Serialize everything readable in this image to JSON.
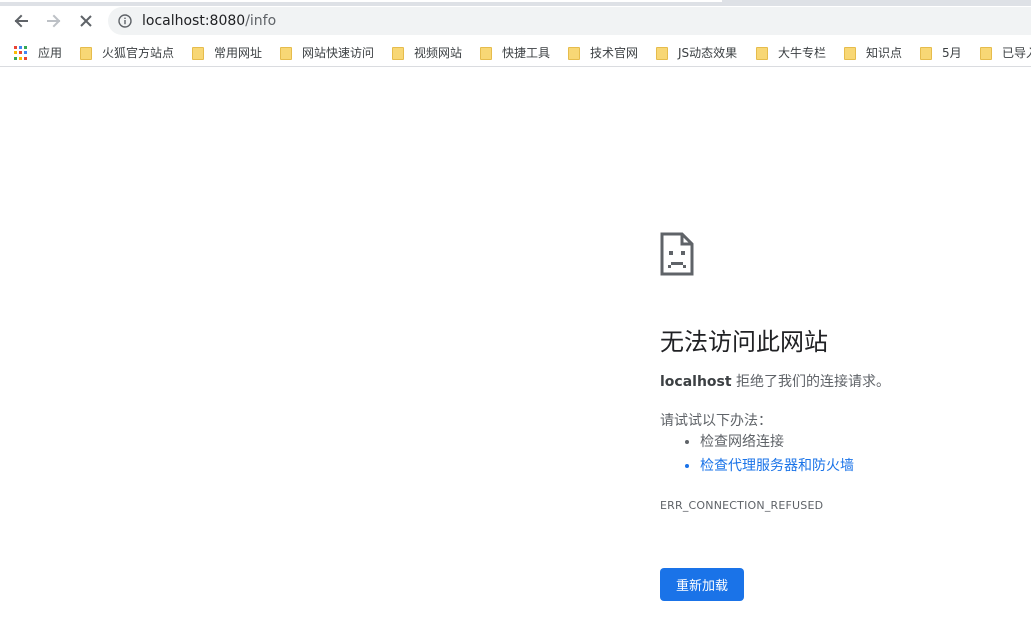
{
  "toolbar": {
    "back_icon": "arrow-left-icon",
    "forward_icon": "arrow-right-icon",
    "stop_icon": "close-icon",
    "security_icon": "info-icon",
    "url_host": "localhost:8080",
    "url_path": "/info"
  },
  "bookmarks": {
    "apps_label": "应用",
    "apps_colors": [
      "#ea4335",
      "#4285f4",
      "#34a853",
      "#fbbc05",
      "#ea4335",
      "#4285f4",
      "#34a853",
      "#fbbc05",
      "#ea4335"
    ],
    "items": [
      {
        "label": "火狐官方站点"
      },
      {
        "label": "常用网址"
      },
      {
        "label": "网站快速访问"
      },
      {
        "label": "视频网站"
      },
      {
        "label": "快捷工具"
      },
      {
        "label": "技术官网"
      },
      {
        "label": "JS动态效果"
      },
      {
        "label": "大牛专栏"
      },
      {
        "label": "知识点"
      },
      {
        "label": "5月"
      },
      {
        "label": "已导入"
      }
    ]
  },
  "error": {
    "icon": "sad-page-icon",
    "title": "无法访问此网站",
    "host": "localhost",
    "detail": " 拒绝了我们的连接请求。",
    "try_label": "请试试以下办法：",
    "suggestions": [
      {
        "label": "检查网络连接"
      },
      {
        "label": "检查代理服务器和防火墙"
      }
    ],
    "code": "ERR_CONNECTION_REFUSED",
    "reload_label": "重新加载"
  },
  "colors": {
    "accent": "#1a73e8",
    "omnibox_bg": "#f1f3f4",
    "folder": "#f8d775"
  }
}
